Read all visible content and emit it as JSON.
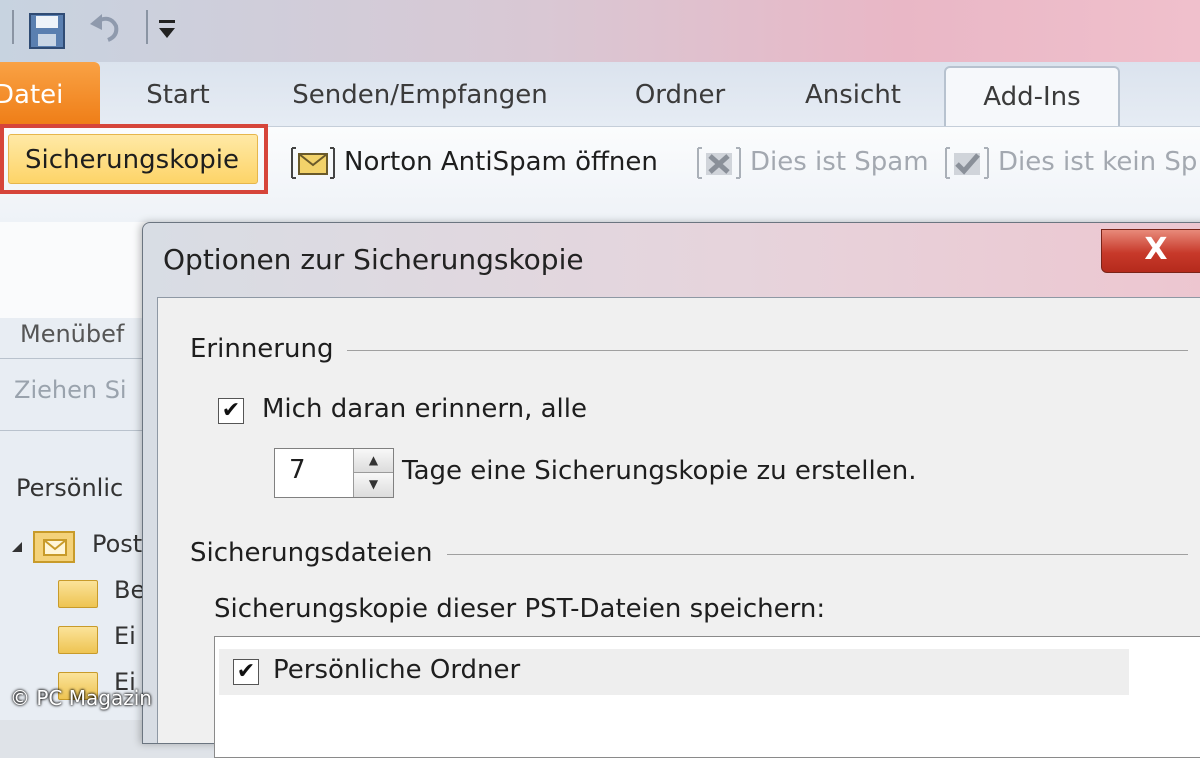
{
  "quick_access": {
    "icons": [
      "save-icon",
      "undo-icon",
      "customize-arrow-icon"
    ]
  },
  "tabs": [
    {
      "label": "Datei"
    },
    {
      "label": "Start"
    },
    {
      "label": "Senden/Empfangen"
    },
    {
      "label": "Ordner"
    },
    {
      "label": "Ansicht"
    },
    {
      "label": "Add-Ins"
    }
  ],
  "ribbon": {
    "backup_button": "Sicherungskopie",
    "norton_open": "Norton AntiSpam öffnen",
    "is_spam": "Dies ist Spam",
    "not_spam": "Dies ist kein Sp"
  },
  "nav": {
    "menu_commands": "Menübef",
    "drag_hint": "Ziehen Si",
    "personal_folders": "Persönlic",
    "inbox": "Post",
    "folder_1": "Be",
    "folder_2": "Ei",
    "folder_3": "Ei"
  },
  "watermark": "© PC Magazin",
  "dialog": {
    "title": "Optionen zur Sicherungskopie",
    "close_label": "X",
    "reminder_group": "Erinnerung",
    "remind_checkbox_label": "Mich daran erinnern, alle",
    "remind_checked": true,
    "days_value": "7",
    "days_suffix": "Tage eine Sicherungskopie zu erstellen.",
    "backup_files_group": "Sicherungsdateien",
    "pst_prompt": "Sicherungskopie dieser PST-Dateien speichern:",
    "pst_files": [
      {
        "label": "Persönliche Ordner",
        "checked": true
      }
    ]
  },
  "colors": {
    "file_tab": "#ef7d16",
    "highlight_border": "#d6453a",
    "close_button": "#c7392a"
  }
}
